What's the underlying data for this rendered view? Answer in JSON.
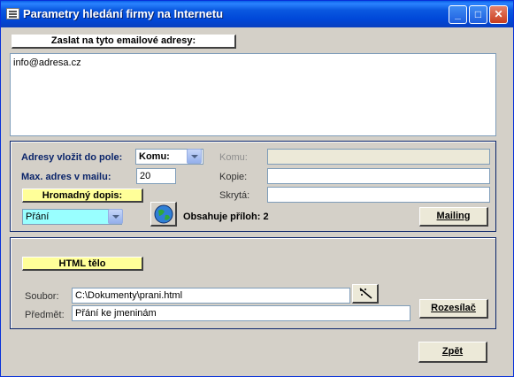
{
  "window": {
    "title": "Parametry hledání firmy na Internetu"
  },
  "recipients": {
    "header": "Zaslat na tyto emailové adresy:",
    "value": "info@adresa.cz"
  },
  "settings": {
    "field_label": "Adresy vložit do pole:",
    "field_value": "Komu:",
    "max_label": "Max. adres v mailu:",
    "max_value": "20",
    "komu_label": "Komu:",
    "kopie_label": "Kopie:",
    "skryta_label": "Skrytá:",
    "bulk_label": "Hromadný dopis:",
    "bulk_value": "Přání",
    "attachments_text": "Obsahuje příloh: 2",
    "mailing_button": "Mailing"
  },
  "html_body": {
    "header": "HTML tělo",
    "file_label": "Soubor:",
    "file_value": "C:\\Dokumenty\\prani.html",
    "subject_label": "Předmět:",
    "subject_value": "Přání ke jmeninám",
    "send_button": "Rozesílač"
  },
  "footer": {
    "back_button": "Zpět"
  },
  "colors": {
    "accent_yellow": "#ffff99",
    "window_bg": "#d4d0c8",
    "title_blue": "#0054e3"
  }
}
